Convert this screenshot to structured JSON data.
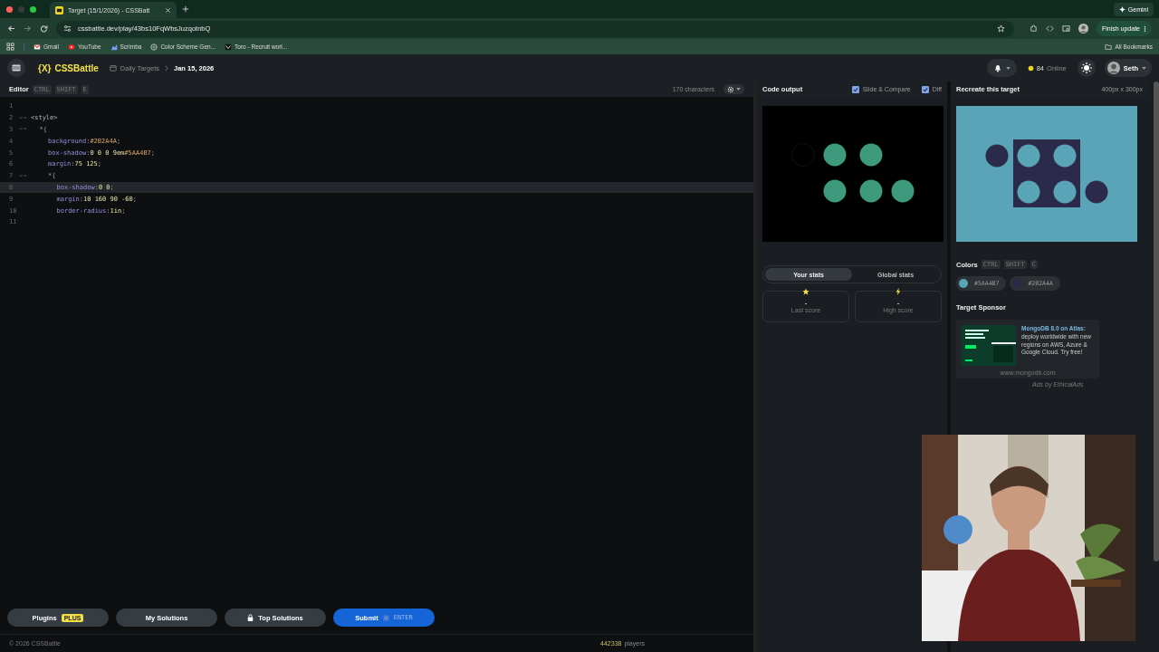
{
  "browser": {
    "tabs": [
      {
        "title": "Target (15/1/2026) - CSSBatt",
        "selected": true
      }
    ],
    "url": "cssbattle.dev/play/43bs10FqWbsJuzqotnbQ",
    "gemini": "Gemini",
    "finish_update": "Finish update",
    "bookmarks": [
      "Gmail",
      "YouTube",
      "Scrimba",
      "Color Scheme Gen...",
      "Toro - Recruit worl..."
    ],
    "all_bookmarks": "All Bookmarks"
  },
  "header": {
    "logo_mark": "{X}",
    "logo_text": "CSSBattle",
    "breadcrumb": "Daily Targets",
    "date": "Jan 15, 2026",
    "online_count": "84",
    "online_label": "Online",
    "user": "Seth"
  },
  "editor": {
    "title": "Editor",
    "keys": [
      "CTRL",
      "SHIFT",
      "E"
    ],
    "characters": "170 characters",
    "lines": [
      {
        "number": "1",
        "fold": false,
        "selected": false
      },
      {
        "number": "2",
        "fold": true,
        "selected": false,
        "tokens": [
          {
            "kind": "tag",
            "text": "<style>"
          }
        ],
        "children": [
          {
            "number": "3",
            "fold": true,
            "selected": false,
            "tokens": [
              {
                "kind": "punct",
                "text": "*{"
              }
            ],
            "children": [
              {
                "number": "4",
                "fold": false,
                "selected": false,
                "tokens": [
                  {
                    "kind": "prop",
                    "text": "background"
                  },
                  {
                    "kind": "punct",
                    "text": ":"
                  },
                  {
                    "kind": "color",
                    "text": "#2B2A4A"
                  },
                  {
                    "kind": "punct",
                    "text": ";"
                  }
                ]
              },
              {
                "number": "5",
                "fold": false,
                "selected": false,
                "tokens": [
                  {
                    "kind": "prop",
                    "text": "box-shadow"
                  },
                  {
                    "kind": "punct",
                    "text": ":"
                  },
                  {
                    "kind": "num",
                    "text": "0 0 0 9em"
                  },
                  {
                    "kind": "color",
                    "text": "#5AA4B7"
                  },
                  {
                    "kind": "punct",
                    "text": ";"
                  }
                ]
              },
              {
                "number": "6",
                "fold": false,
                "selected": false,
                "tokens": [
                  {
                    "kind": "prop",
                    "text": "margin"
                  },
                  {
                    "kind": "punct",
                    "text": ":"
                  },
                  {
                    "kind": "num",
                    "text": "75 125"
                  },
                  {
                    "kind": "punct",
                    "text": ";"
                  }
                ]
              },
              {
                "number": "7",
                "fold": true,
                "selected": false,
                "tokens": [
                  {
                    "kind": "punct",
                    "text": "*{"
                  }
                ],
                "children": [
                  {
                    "number": "8",
                    "fold": false,
                    "selected": true,
                    "tokens": [
                      {
                        "kind": "prop",
                        "text": "box-shadow"
                      },
                      {
                        "kind": "punct",
                        "text": ":"
                      },
                      {
                        "kind": "num",
                        "text": "0 0"
                      },
                      {
                        "kind": "punct",
                        "text": ";"
                      }
                    ]
                  },
                  {
                    "number": "9",
                    "fold": false,
                    "selected": false,
                    "tokens": [
                      {
                        "kind": "prop",
                        "text": "margin"
                      },
                      {
                        "kind": "punct",
                        "text": ":"
                      },
                      {
                        "kind": "num",
                        "text": "10 160 90 -60"
                      },
                      {
                        "kind": "punct",
                        "text": ";"
                      }
                    ]
                  },
                  {
                    "number": "10",
                    "fold": false,
                    "selected": false,
                    "tokens": [
                      {
                        "kind": "prop",
                        "text": "border-radius"
                      },
                      {
                        "kind": "punct",
                        "text": ":"
                      },
                      {
                        "kind": "num",
                        "text": "1in"
                      },
                      {
                        "kind": "punct",
                        "text": ";"
                      }
                    ]
                  }
                ]
              }
            ]
          }
        ]
      },
      {
        "number": "11",
        "fold": false,
        "selected": false
      }
    ]
  },
  "output": {
    "title": "Code output",
    "options": [
      {
        "label": "Slide & Compare",
        "checked": true
      },
      {
        "label": "Diff",
        "checked": true
      }
    ],
    "stats_tabs": [
      {
        "label": "Your stats",
        "selected": true
      },
      {
        "label": "Global stats",
        "selected": false
      }
    ],
    "stats": [
      {
        "kind": "star",
        "value": "-",
        "label": "Last score"
      },
      {
        "kind": "bolt",
        "value": "-",
        "label": "High score"
      }
    ]
  },
  "target": {
    "title": "Recreate this target",
    "size": "400px x 300px",
    "colors_title": "Colors",
    "keys": [
      "CTRL",
      "SHIFT",
      "C"
    ],
    "colors": [
      {
        "label": "#5AA4B7",
        "color": "#5aa4b7"
      },
      {
        "label": "#2B2A4A",
        "color": "#2b2a4a"
      }
    ],
    "sponsor_title": "Target Sponsor",
    "ad_text": "**MongoDB 8.0 on Atlas:** deploy worldwide with new regions on AWS, Azure & Google Cloud. Try free!",
    "ad_url": "www.mongodb.com",
    "ad_credit": "Ads by EthicalAds"
  },
  "actions": [
    {
      "kind": "plugins",
      "label": "Plugins",
      "badge": "PLUS"
    },
    {
      "kind": "plain",
      "label": "My Solutions"
    },
    {
      "kind": "locked",
      "label": "Top Solutions"
    },
    {
      "kind": "submit",
      "label": "Submit",
      "key": "ENTER"
    }
  ],
  "footer": {
    "copyright": "© 2026 CSSBattle",
    "players_count": "442338",
    "players_label": "players"
  }
}
